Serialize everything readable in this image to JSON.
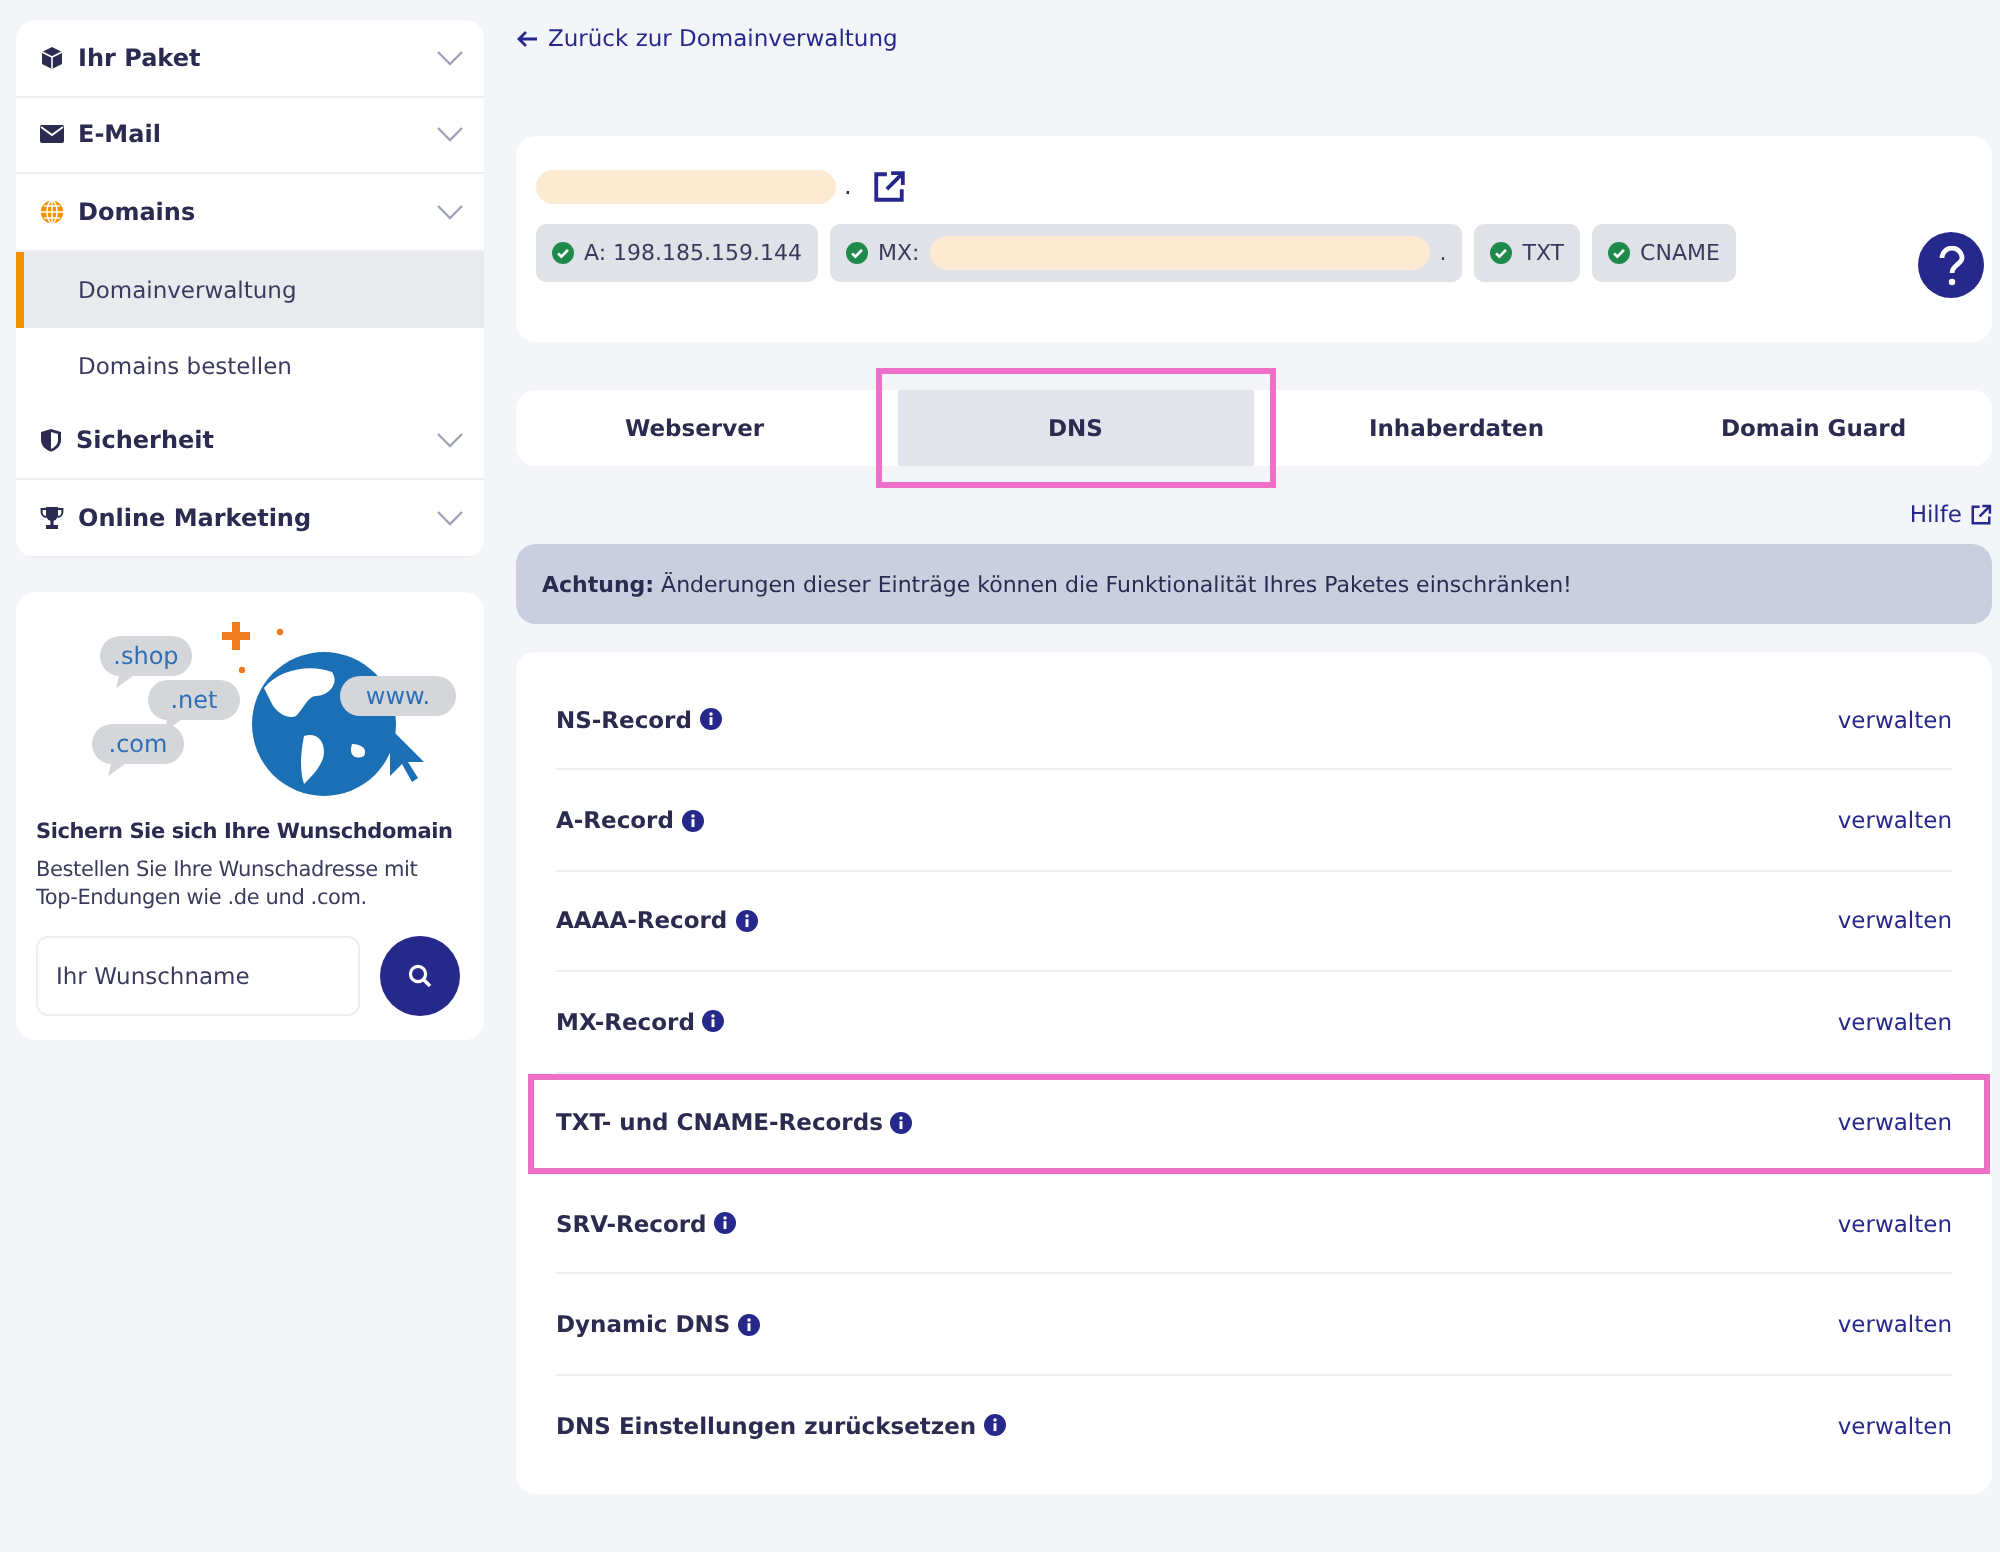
{
  "sidebar": {
    "items": [
      {
        "label": "Ihr Paket"
      },
      {
        "label": "E-Mail"
      },
      {
        "label": "Domains",
        "children": [
          {
            "label": "Domainverwaltung",
            "selected": true
          },
          {
            "label": "Domains bestellen",
            "selected": false
          }
        ]
      },
      {
        "label": "Sicherheit"
      },
      {
        "label": "Online Marketing"
      }
    ]
  },
  "promo": {
    "tlds": [
      ".shop",
      ".net",
      ".com",
      "www."
    ],
    "title": "Sichern Sie sich Ihre Wunschdomain",
    "text": "Bestellen Sie Ihre Wunschadresse mit Top-Endungen wie .de und .com.",
    "placeholder": "Ihr Wunschname"
  },
  "back_link": "Zurück zur Domainverwaltung",
  "domain": {
    "name_suffix": ".",
    "records": [
      {
        "label": "A: 198.185.159.144",
        "redacted": false
      },
      {
        "label": "MX:",
        "redacted": true,
        "suffix": "."
      },
      {
        "label": "TXT",
        "redacted": false
      },
      {
        "label": "CNAME",
        "redacted": false
      }
    ]
  },
  "tabs": [
    {
      "label": "Webserver",
      "selected": false,
      "highlighted": false
    },
    {
      "label": "DNS",
      "selected": true,
      "highlighted": true
    },
    {
      "label": "Inhaberdaten",
      "selected": false,
      "highlighted": false
    },
    {
      "label": "Domain Guard",
      "selected": false,
      "highlighted": false
    }
  ],
  "help_link": "Hilfe",
  "alert": "**Achtung:** Änderungen dieser Einträge können die Funktionalität Ihres Paketes einschränken!",
  "records": [
    {
      "label": "NS-Record",
      "action": "verwalten",
      "highlighted": false
    },
    {
      "label": "A-Record",
      "action": "verwalten",
      "highlighted": false
    },
    {
      "label": "AAAA-Record",
      "action": "verwalten",
      "highlighted": false
    },
    {
      "label": "MX-Record",
      "action": "verwalten",
      "highlighted": false
    },
    {
      "label": "TXT- und CNAME-Records",
      "action": "verwalten",
      "highlighted": true
    },
    {
      "label": "SRV-Record",
      "action": "verwalten",
      "highlighted": false
    },
    {
      "label": "Dynamic DNS",
      "action": "verwalten",
      "highlighted": false
    },
    {
      "label": "DNS Einstellungen zurücksetzen",
      "action": "verwalten",
      "highlighted": false
    }
  ]
}
